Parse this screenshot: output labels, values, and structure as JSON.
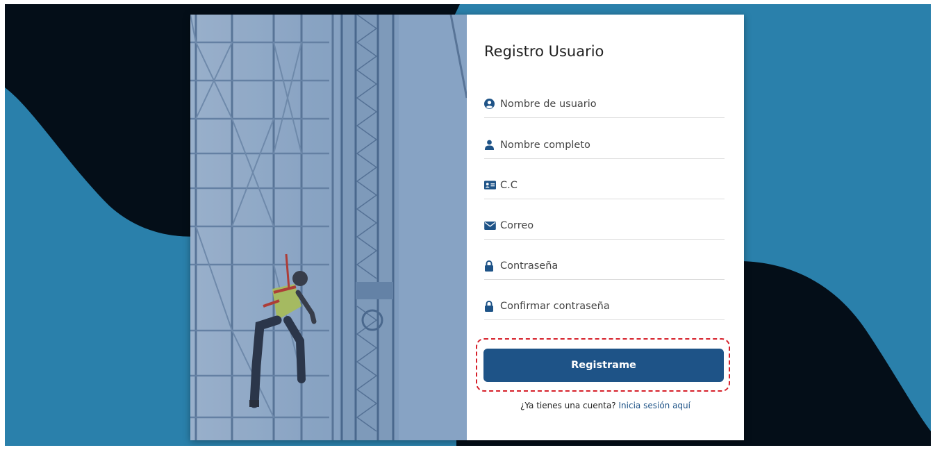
{
  "colors": {
    "background_blue": "#2a80ab",
    "background_dark": "#040e18",
    "button": "#1e5387",
    "link": "#1e5387",
    "highlight_dashed": "#d6202a"
  },
  "form": {
    "title": "Registro Usuario",
    "fields": [
      {
        "icon": "user-circle-icon",
        "label": "Nombre de usuario"
      },
      {
        "icon": "user-icon",
        "label": "Nombre completo"
      },
      {
        "icon": "id-card-icon",
        "label": "C.C"
      },
      {
        "icon": "envelope-icon",
        "label": "Correo"
      },
      {
        "icon": "lock-icon",
        "label": "Contraseña"
      },
      {
        "icon": "lock-icon",
        "label": "Confirmar contraseña"
      }
    ],
    "submit_label": "Registrame",
    "login_prompt": "¿Ya tienes una cuenta?",
    "login_link": "Inicia sesión aquí"
  },
  "image": {
    "icon": "construction-worker-photo"
  }
}
